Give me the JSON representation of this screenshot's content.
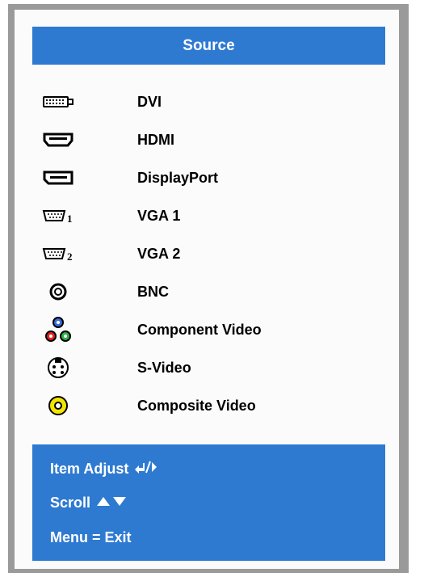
{
  "title": "Source",
  "sources": [
    {
      "label": "DVI",
      "icon": "dvi-port-icon"
    },
    {
      "label": "HDMI",
      "icon": "hdmi-port-icon"
    },
    {
      "label": "DisplayPort",
      "icon": "displayport-icon"
    },
    {
      "label": "VGA 1",
      "icon": "vga-port-icon",
      "icon_suffix": "1"
    },
    {
      "label": "VGA 2",
      "icon": "vga-port-icon",
      "icon_suffix": "2"
    },
    {
      "label": "BNC",
      "icon": "bnc-connector-icon"
    },
    {
      "label": "Component Video",
      "icon": "component-video-icon"
    },
    {
      "label": "S-Video",
      "icon": "s-video-icon"
    },
    {
      "label": "Composite Video",
      "icon": "composite-video-icon"
    }
  ],
  "footer": {
    "item_adjust": "Item Adjust",
    "scroll": "Scroll",
    "menu_exit": "Menu = Exit"
  },
  "colors": {
    "accent": "#2e7ad1",
    "frame": "#9a9a9a",
    "panel": "#fbfbfb"
  }
}
